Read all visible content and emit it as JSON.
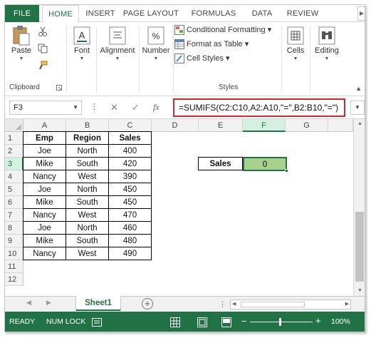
{
  "tabs": [
    "FILE",
    "HOME",
    "INSERT",
    "PAGE LAYOUT",
    "FORMULAS",
    "DATA",
    "REVIEW"
  ],
  "ribbon": {
    "paste": "Paste",
    "font": "Font",
    "alignment": "Alignment",
    "number": "Number",
    "conditional_formatting": "Conditional Formatting",
    "format_as_table": "Format as Table",
    "cell_styles": "Cell Styles",
    "cells": "Cells",
    "editing": "Editing",
    "clipboard_label": "Clipboard",
    "styles_label": "Styles"
  },
  "formula_bar": {
    "name_box": "F3",
    "fx": "fx",
    "formula": "=SUMIFS(C2:C10,A2:A10,\"=\",B2:B10,\"=\")"
  },
  "columns": [
    "A",
    "B",
    "C",
    "D",
    "E",
    "F",
    "G"
  ],
  "rows": [
    "1",
    "2",
    "3",
    "4",
    "5",
    "6",
    "7",
    "8",
    "9",
    "10",
    "11",
    "12"
  ],
  "table": {
    "headers": [
      "Emp",
      "Region",
      "Sales"
    ],
    "rows": [
      [
        "Joe",
        "North",
        "400"
      ],
      [
        "Mike",
        "South",
        "420"
      ],
      [
        "Nancy",
        "West",
        "390"
      ],
      [
        "Joe",
        "North",
        "450"
      ],
      [
        "Mike",
        "South",
        "450"
      ],
      [
        "Nancy",
        "West",
        "470"
      ],
      [
        "Joe",
        "North",
        "460"
      ],
      [
        "Mike",
        "South",
        "480"
      ],
      [
        "Nancy",
        "West",
        "490"
      ]
    ]
  },
  "result": {
    "label": "Sales",
    "value": "0"
  },
  "sheet_tab": "Sheet1",
  "status": {
    "ready": "READY",
    "num_lock": "NUM LOCK",
    "zoom": "100%"
  },
  "colors": {
    "excel_green": "#217346",
    "highlight_red": "#d9252e",
    "result_fill": "#a9d18e"
  }
}
